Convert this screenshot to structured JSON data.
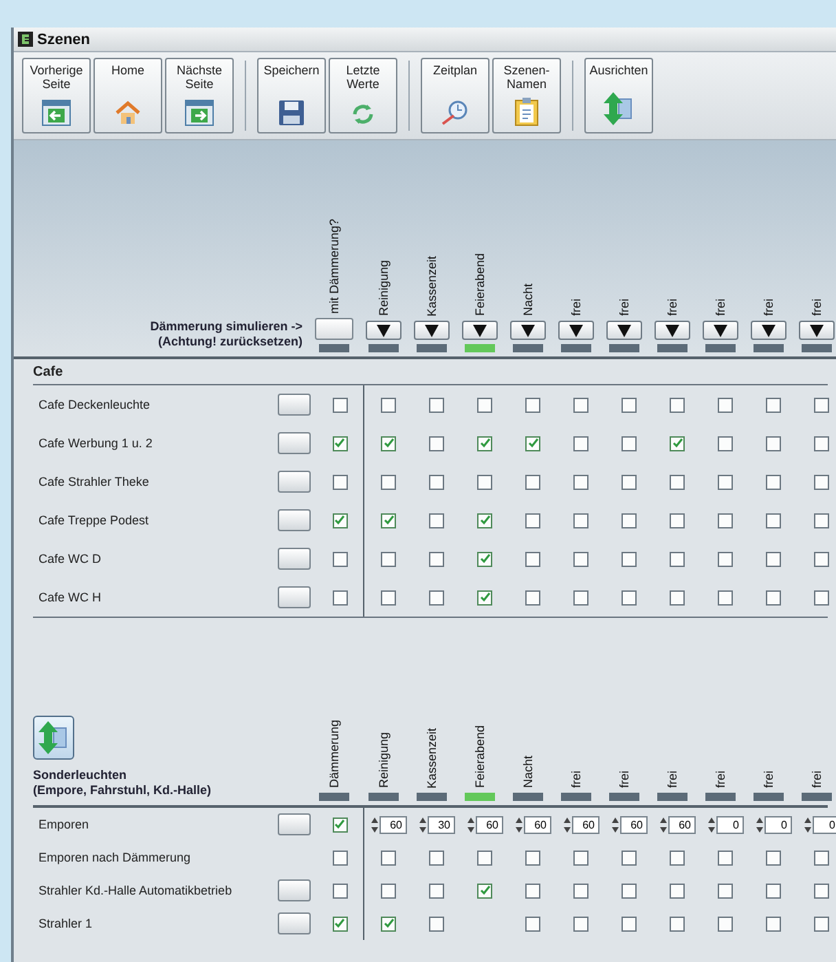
{
  "window": {
    "title": "Szenen"
  },
  "toolbar": [
    {
      "buttons": [
        {
          "label": "Vorherige Seite",
          "kind": "back"
        },
        {
          "label": "Home",
          "kind": "home"
        },
        {
          "label": "Nächste Seite",
          "kind": "forward"
        }
      ]
    },
    {
      "buttons": [
        {
          "label": "Speichern",
          "kind": "save"
        },
        {
          "label": "Letzte Werte",
          "kind": "recycle"
        }
      ]
    },
    {
      "buttons": [
        {
          "label": "Zeitplan",
          "kind": "schedule"
        },
        {
          "label": "Szenen-Namen",
          "kind": "clipboard"
        }
      ]
    },
    {
      "buttons": [
        {
          "label": "Ausrichten",
          "kind": "align"
        }
      ]
    }
  ],
  "sections": [
    {
      "kind": "simulate",
      "header_lines": [
        "Dämmerung simulieren ->",
        "(Achtung! zurücksetzen)"
      ],
      "title": "Cafe",
      "columns": [
        {
          "label": "mit Dämmerung?",
          "kind": "button",
          "active": false
        },
        {
          "label": "Reinigung",
          "kind": "dropdown",
          "active": false
        },
        {
          "label": "Kassenzeit",
          "kind": "dropdown",
          "active": false
        },
        {
          "label": "Feierabend",
          "kind": "dropdown",
          "active": true
        },
        {
          "label": "Nacht",
          "kind": "dropdown",
          "active": false
        },
        {
          "label": "frei",
          "kind": "dropdown",
          "active": false
        },
        {
          "label": "frei",
          "kind": "dropdown",
          "active": false
        },
        {
          "label": "frei",
          "kind": "dropdown",
          "active": false
        },
        {
          "label": "frei",
          "kind": "dropdown",
          "active": false
        },
        {
          "label": "frei",
          "kind": "dropdown",
          "active": false
        },
        {
          "label": "frei",
          "kind": "dropdown",
          "active": false
        }
      ],
      "rows": [
        {
          "name": "Cafe Deckenleuchte",
          "button": true,
          "dusk": false,
          "cells": [
            {
              "kind": "check",
              "checked": false
            },
            {
              "kind": "check",
              "checked": false
            },
            {
              "kind": "check",
              "checked": false
            },
            {
              "kind": "check",
              "checked": false
            },
            {
              "kind": "check",
              "checked": false
            },
            {
              "kind": "check",
              "checked": false
            },
            {
              "kind": "check",
              "checked": false
            },
            {
              "kind": "check",
              "checked": false
            },
            {
              "kind": "check",
              "checked": false
            },
            {
              "kind": "check",
              "checked": false
            }
          ]
        },
        {
          "name": "Cafe Werbung 1 u. 2",
          "button": true,
          "dusk": true,
          "cells": [
            {
              "kind": "check",
              "checked": true
            },
            {
              "kind": "check",
              "checked": false
            },
            {
              "kind": "check",
              "checked": true
            },
            {
              "kind": "check",
              "checked": true
            },
            {
              "kind": "check",
              "checked": false
            },
            {
              "kind": "check",
              "checked": false
            },
            {
              "kind": "check",
              "checked": true
            },
            {
              "kind": "check",
              "checked": false
            },
            {
              "kind": "check",
              "checked": false
            },
            {
              "kind": "check",
              "checked": false
            }
          ]
        },
        {
          "name": "Cafe Strahler Theke",
          "button": true,
          "dusk": false,
          "cells": [
            {
              "kind": "check",
              "checked": false
            },
            {
              "kind": "check",
              "checked": false
            },
            {
              "kind": "check",
              "checked": false
            },
            {
              "kind": "check",
              "checked": false
            },
            {
              "kind": "check",
              "checked": false
            },
            {
              "kind": "check",
              "checked": false
            },
            {
              "kind": "check",
              "checked": false
            },
            {
              "kind": "check",
              "checked": false
            },
            {
              "kind": "check",
              "checked": false
            },
            {
              "kind": "check",
              "checked": false
            }
          ]
        },
        {
          "name": "Cafe Treppe Podest",
          "button": true,
          "dusk": true,
          "cells": [
            {
              "kind": "check",
              "checked": true
            },
            {
              "kind": "check",
              "checked": false
            },
            {
              "kind": "check",
              "checked": true
            },
            {
              "kind": "check",
              "checked": false
            },
            {
              "kind": "check",
              "checked": false
            },
            {
              "kind": "check",
              "checked": false
            },
            {
              "kind": "check",
              "checked": false
            },
            {
              "kind": "check",
              "checked": false
            },
            {
              "kind": "check",
              "checked": false
            },
            {
              "kind": "check",
              "checked": false
            }
          ]
        },
        {
          "name": "Cafe WC D",
          "button": true,
          "dusk": false,
          "cells": [
            {
              "kind": "check",
              "checked": false
            },
            {
              "kind": "check",
              "checked": false
            },
            {
              "kind": "check",
              "checked": true
            },
            {
              "kind": "check",
              "checked": false
            },
            {
              "kind": "check",
              "checked": false
            },
            {
              "kind": "check",
              "checked": false
            },
            {
              "kind": "check",
              "checked": false
            },
            {
              "kind": "check",
              "checked": false
            },
            {
              "kind": "check",
              "checked": false
            },
            {
              "kind": "check",
              "checked": false
            }
          ]
        },
        {
          "name": "Cafe WC H",
          "button": true,
          "dusk": false,
          "cells": [
            {
              "kind": "check",
              "checked": false
            },
            {
              "kind": "check",
              "checked": false
            },
            {
              "kind": "check",
              "checked": true
            },
            {
              "kind": "check",
              "checked": false
            },
            {
              "kind": "check",
              "checked": false
            },
            {
              "kind": "check",
              "checked": false
            },
            {
              "kind": "check",
              "checked": false
            },
            {
              "kind": "check",
              "checked": false
            },
            {
              "kind": "check",
              "checked": false
            },
            {
              "kind": "check",
              "checked": false
            }
          ]
        }
      ]
    },
    {
      "kind": "special",
      "header_lines": [
        "Sonderleuchten",
        "(Empore, Fahrstuhl, Kd.-Halle)"
      ],
      "columns": [
        {
          "label": "Dämmerung",
          "kind": "label",
          "active": false
        },
        {
          "label": "Reinigung",
          "kind": "label",
          "active": false
        },
        {
          "label": "Kassenzeit",
          "kind": "label",
          "active": false
        },
        {
          "label": "Feierabend",
          "kind": "label",
          "active": true
        },
        {
          "label": "Nacht",
          "kind": "label",
          "active": false
        },
        {
          "label": "frei",
          "kind": "label",
          "active": false
        },
        {
          "label": "frei",
          "kind": "label",
          "active": false
        },
        {
          "label": "frei",
          "kind": "label",
          "active": false
        },
        {
          "label": "frei",
          "kind": "label",
          "active": false
        },
        {
          "label": "frei",
          "kind": "label",
          "active": false
        },
        {
          "label": "frei",
          "kind": "label",
          "active": false
        }
      ],
      "rows": [
        {
          "name": "Emporen",
          "button": true,
          "dusk": true,
          "cells": [
            {
              "kind": "number",
              "value": "60"
            },
            {
              "kind": "number",
              "value": "30"
            },
            {
              "kind": "number",
              "value": "60"
            },
            {
              "kind": "number",
              "value": "60"
            },
            {
              "kind": "number",
              "value": "60"
            },
            {
              "kind": "number",
              "value": "60"
            },
            {
              "kind": "number",
              "value": "60"
            },
            {
              "kind": "number",
              "value": "0"
            },
            {
              "kind": "number",
              "value": "0"
            },
            {
              "kind": "number",
              "value": "0"
            }
          ]
        },
        {
          "name": "Emporen nach Dämmerung",
          "button": false,
          "dusk": false,
          "cells": [
            {
              "kind": "check",
              "checked": false
            },
            {
              "kind": "check",
              "checked": false
            },
            {
              "kind": "check",
              "checked": false
            },
            {
              "kind": "check",
              "checked": false
            },
            {
              "kind": "check",
              "checked": false
            },
            {
              "kind": "check",
              "checked": false
            },
            {
              "kind": "check",
              "checked": false
            },
            {
              "kind": "check",
              "checked": false
            },
            {
              "kind": "check",
              "checked": false
            },
            {
              "kind": "check",
              "checked": false
            }
          ]
        },
        {
          "name": "Strahler Kd.-Halle Automatikbetrieb",
          "button": true,
          "dusk": false,
          "cells": [
            {
              "kind": "check",
              "checked": false
            },
            {
              "kind": "check",
              "checked": false
            },
            {
              "kind": "check",
              "checked": true
            },
            {
              "kind": "check",
              "checked": false
            },
            {
              "kind": "check",
              "checked": false
            },
            {
              "kind": "check",
              "checked": false
            },
            {
              "kind": "check",
              "checked": false
            },
            {
              "kind": "check",
              "checked": false
            },
            {
              "kind": "check",
              "checked": false
            },
            {
              "kind": "check",
              "checked": false
            }
          ]
        },
        {
          "name": "Strahler 1",
          "button": true,
          "dusk": true,
          "cells": [
            {
              "kind": "check",
              "checked": true
            },
            {
              "kind": "check",
              "checked": false
            },
            {
              "kind": "empty"
            },
            {
              "kind": "check",
              "checked": false
            },
            {
              "kind": "check",
              "checked": false
            },
            {
              "kind": "check",
              "checked": false
            },
            {
              "kind": "check",
              "checked": false
            },
            {
              "kind": "check",
              "checked": false
            },
            {
              "kind": "check",
              "checked": false
            },
            {
              "kind": "check",
              "checked": false
            }
          ]
        }
      ]
    }
  ]
}
